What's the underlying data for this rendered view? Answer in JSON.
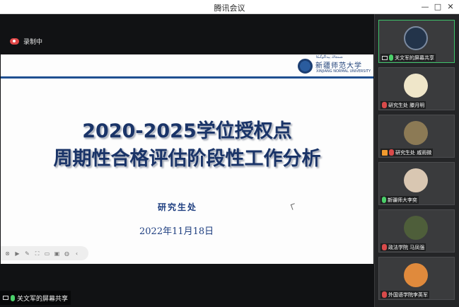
{
  "window": {
    "title": "腾讯会议",
    "minimize": "—",
    "maximize": "□",
    "close": "✕"
  },
  "recording": {
    "label": "录制中"
  },
  "slide": {
    "logo_name": "新疆师范大学",
    "logo_sub": "XINJIANG NORMAL UNIVERSITY",
    "logo_tiny": "شىنجاڭ پېداگوگىكا",
    "title_line1": "2020-2025学位授权点",
    "title_line2": "周期性合格评估阶段性工作分析",
    "department": "研究生处",
    "date": "2022年11月18日"
  },
  "share_toolbar": {
    "items": [
      "close-icon",
      "play-icon",
      "pen-icon",
      "screenshot-icon",
      "record-icon",
      "comment-icon",
      "globe-icon",
      "collapse-icon"
    ]
  },
  "share_status": {
    "label": "关文军的屏幕共享"
  },
  "participants": [
    {
      "name": "关文军的屏幕共享",
      "icon": "screen-share-icon",
      "mic": "on",
      "avatar_color": "#23344a"
    },
    {
      "name": "研究生处 滕月明",
      "icon": "mic-muted-icon",
      "mic": "off",
      "avatar_color": "#efe6c9"
    },
    {
      "name": "研究生处 戚雨微",
      "icon": "person-icon",
      "mic": "off",
      "avatar_color": "#8c7a55"
    },
    {
      "name": "新疆师大李奕",
      "icon": "mic-icon",
      "mic": "on",
      "avatar_color": "#d9c7b2"
    },
    {
      "name": "政法学院 马凤强",
      "icon": "mic-muted-icon",
      "mic": "off",
      "avatar_color": "#4e5e3a"
    },
    {
      "name": "外国语学院李英军",
      "icon": "mic-muted-icon",
      "mic": "off",
      "avatar_color": "#e08a3c"
    }
  ]
}
